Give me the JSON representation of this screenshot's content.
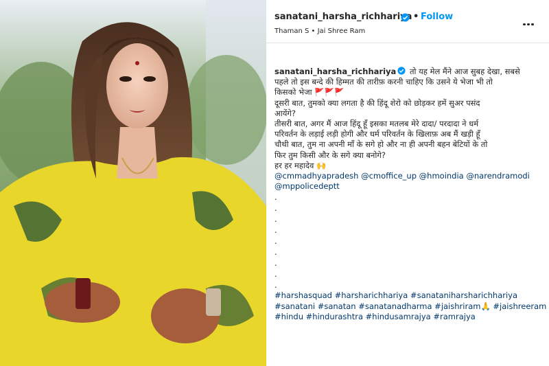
{
  "post": {
    "username": "sanatani_harsha_richhariya",
    "separator": "•",
    "follow_label": "Follow",
    "audio": "Thaman S • Jai Shree Ram"
  },
  "caption": {
    "username": "sanatani_harsha_richhariya",
    "line1": "तो यह मेल मैंने आज सुबह देखा, सबसे",
    "line2": "पहले तो इस बन्दे की हिम्मत की तारीफ़ करनी चाहिए कि उसने ये भेजा भी तो",
    "line3": "किसको भेजा",
    "line3_flags": "🚩🚩🚩",
    "line4": "दूसरी बात, तुमको क्या लगता है की हिंदू शेरो को छोड़कर हमें सुअर पसंद",
    "line5": "आयेंगे?",
    "line6": "तीसरी बात, अगर मैं आज हिंदू हूँ इसका मतलब मेरे दादा/ परदादा ने धर्म",
    "line7": "परिवर्तन के लड़ाई लड़ी होगी और धर्म परिवर्तन के खिलाफ़ अब मैं खड़ी हूँ",
    "line8": "चौथी बात, तुम ना अपनी माँ के सगे हो और ना ही अपनी बहन बेटियों के तो",
    "line9": "फिर तुम किसी और के सगे क्या बनोगे?",
    "line10": "हर हर महादेव 🙌",
    "mentions_line1": "@cmmadhyapradesh @cmoffice_up @hmoindia @narendramodi",
    "mentions_line2": "@mppolicedeptt",
    "dots": [
      ".",
      ".",
      ".",
      ".",
      ".",
      ".",
      ".",
      ".",
      "."
    ],
    "tags_line1": "#harshasquad #harsharichhariya #sanataniharsharichhariya",
    "tags_line2": "#sanatani #sanatan #sanatanadharma #jaishriram🙏 #jaishreeram",
    "tags_line3": "#hindu #hindurashtra #hindusamrajya #ramrajya"
  },
  "colors": {
    "follow": "#0095f6",
    "verified": "#0095f6",
    "link": "#00376b",
    "text": "#262626"
  }
}
